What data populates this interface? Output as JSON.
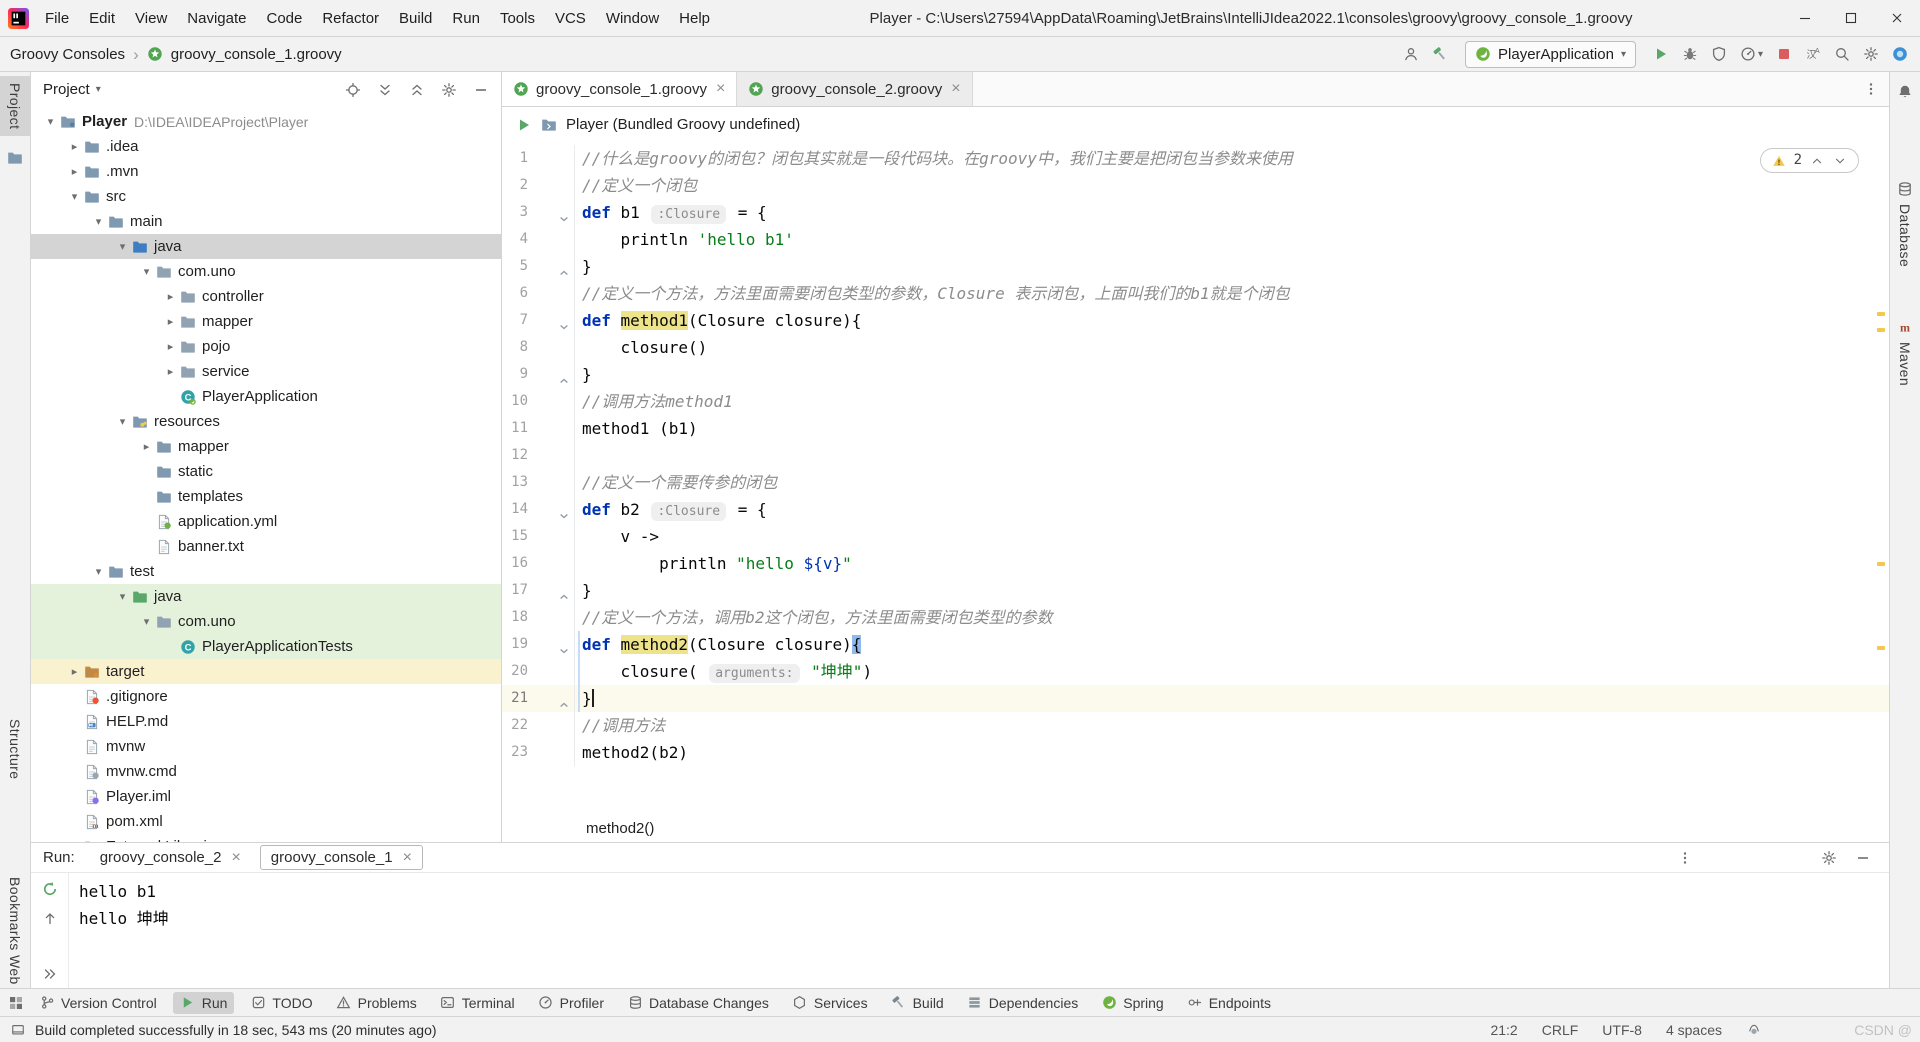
{
  "colors": {
    "accent_green": "#59A869",
    "warning_yellow": "#F2C94C",
    "selection_gray": "#D4D4D4",
    "test_green_bg": "#E4F2DC",
    "excluded_yellow_bg": "#FAF1CE",
    "current_line_bg": "#FCFAED",
    "keyword_blue": "#0033B3",
    "string_green": "#067D17",
    "comment_gray": "#8C8C8C",
    "stop_red": "#DB5C5C"
  },
  "titlebar": {
    "title": "Player - C:\\Users\\27594\\AppData\\Roaming\\JetBrains\\IntelliJIdea2022.1\\consoles\\groovy\\groovy_console_1.groovy",
    "menus": [
      "File",
      "Edit",
      "View",
      "Navigate",
      "Code",
      "Refactor",
      "Build",
      "Run",
      "Tools",
      "VCS",
      "Window",
      "Help"
    ]
  },
  "nav": {
    "breadcrumbs": [
      "Groovy Consoles",
      "groovy_console_1.groovy"
    ]
  },
  "toolbar": {
    "run_config_label": "PlayerApplication",
    "left": [
      {
        "name": "profile-settings",
        "icon": "user"
      },
      {
        "name": "build-project",
        "icon": "hammer"
      }
    ],
    "right": [
      {
        "name": "run",
        "icon": "play"
      },
      {
        "name": "debug",
        "icon": "bug"
      },
      {
        "name": "run-with-coverage",
        "icon": "shield"
      },
      {
        "name": "profiler",
        "icon": "gauge",
        "dropdown": true
      },
      {
        "name": "stop",
        "icon": "stop"
      },
      {
        "name": "translate",
        "icon": "translate"
      },
      {
        "name": "search-everywhere",
        "icon": "search"
      },
      {
        "name": "settings",
        "icon": "gear"
      },
      {
        "name": "code-with-me",
        "icon": "avatar"
      }
    ]
  },
  "left_stripe": [
    "Project",
    "Structure",
    "Bookmarks",
    "Web"
  ],
  "right_stripe": [
    "Database",
    "Maven"
  ],
  "project": {
    "header": "Project",
    "tree": [
      {
        "label": "Player",
        "sub": "D:\\IDEA\\IDEAProject\\Player",
        "icon": "folder-project",
        "level": 0,
        "arrow": "open",
        "bold": true
      },
      {
        "label": ".idea",
        "icon": "folder",
        "level": 1,
        "arrow": "closed"
      },
      {
        "label": ".mvn",
        "icon": "folder",
        "level": 1,
        "arrow": "closed"
      },
      {
        "label": "src",
        "icon": "folder",
        "level": 1,
        "arrow": "open"
      },
      {
        "label": "main",
        "icon": "folder",
        "level": 2,
        "arrow": "open"
      },
      {
        "label": "java",
        "icon": "folder-src",
        "level": 3,
        "arrow": "open",
        "bg": "sel"
      },
      {
        "label": "com.uno",
        "icon": "package",
        "level": 4,
        "arrow": "open"
      },
      {
        "label": "controller",
        "icon": "package",
        "level": 5,
        "arrow": "closed"
      },
      {
        "label": "mapper",
        "icon": "package",
        "level": 5,
        "arrow": "closed"
      },
      {
        "label": "pojo",
        "icon": "package",
        "level": 5,
        "arrow": "closed"
      },
      {
        "label": "service",
        "icon": "package",
        "level": 5,
        "arrow": "closed"
      },
      {
        "label": "PlayerApplication",
        "icon": "class-spring",
        "level": 5
      },
      {
        "label": "resources",
        "icon": "folder-resources",
        "level": 3,
        "arrow": "open"
      },
      {
        "label": "mapper",
        "icon": "folder",
        "level": 4,
        "arrow": "closed"
      },
      {
        "label": "static",
        "icon": "folder",
        "level": 4
      },
      {
        "label": "templates",
        "icon": "folder",
        "level": 4
      },
      {
        "label": "application.yml",
        "icon": "file-yml",
        "level": 4
      },
      {
        "label": "banner.txt",
        "icon": "file-txt",
        "level": 4
      },
      {
        "label": "test",
        "icon": "folder",
        "level": 2,
        "arrow": "open"
      },
      {
        "label": "java",
        "icon": "folder-test",
        "level": 3,
        "arrow": "open",
        "bg": "test"
      },
      {
        "label": "com.uno",
        "icon": "package",
        "level": 4,
        "arrow": "open",
        "bg": "test"
      },
      {
        "label": "PlayerApplicationTests",
        "icon": "class",
        "level": 5,
        "bg": "test"
      },
      {
        "label": "target",
        "icon": "folder-excluded",
        "level": 1,
        "arrow": "closed",
        "bg": "exc"
      },
      {
        "label": ".gitignore",
        "icon": "file-git",
        "level": 1
      },
      {
        "label": "HELP.md",
        "icon": "file-md",
        "level": 1
      },
      {
        "label": "mvnw",
        "icon": "file-plain",
        "level": 1
      },
      {
        "label": "mvnw.cmd",
        "icon": "file-cmd",
        "level": 1
      },
      {
        "label": "Player.iml",
        "icon": "file-iml",
        "level": 1
      },
      {
        "label": "pom.xml",
        "icon": "file-pom",
        "level": 1
      },
      {
        "label": "External Libraries",
        "icon": "folder-lib",
        "level": 1,
        "arrow": "closed"
      }
    ]
  },
  "editor": {
    "tabs": [
      {
        "label": "groovy_console_1.groovy",
        "active": true
      },
      {
        "label": "groovy_console_2.groovy",
        "active": false
      }
    ],
    "run_context": "Player (Bundled Groovy undefined)",
    "warnings": "2",
    "context_breadcrumb": "method2()",
    "lines": [
      {
        "n": 1,
        "segs": [
          [
            "cmt",
            "//什么是groovy的闭包？闭包其实就是一段代码块。在groovy中，我们主要是把闭包当参数来使用"
          ]
        ]
      },
      {
        "n": 2,
        "segs": [
          [
            "cmt",
            "//定义一个闭包"
          ]
        ]
      },
      {
        "n": 3,
        "fold": "down",
        "segs": [
          [
            "kw",
            "def"
          ],
          [
            "plain",
            " b1 "
          ],
          [
            "hint",
            ":Closure"
          ],
          [
            "plain",
            " = {"
          ]
        ]
      },
      {
        "n": 4,
        "segs": [
          [
            "plain",
            "    println "
          ],
          [
            "str",
            "'hello b1'"
          ]
        ]
      },
      {
        "n": 5,
        "fold": "up",
        "segs": [
          [
            "plain",
            "}"
          ]
        ]
      },
      {
        "n": 6,
        "segs": [
          [
            "cmt",
            "//定义一个方法，方法里面需要闭包类型的参数，Closure 表示闭包，上面叫我们的b1就是个闭包"
          ]
        ]
      },
      {
        "n": 7,
        "fold": "down",
        "segs": [
          [
            "kw",
            "def"
          ],
          [
            "plain",
            " "
          ],
          [
            "decl",
            "method1"
          ],
          [
            "plain",
            "(Closure closure){"
          ]
        ]
      },
      {
        "n": 8,
        "segs": [
          [
            "plain",
            "    closure()"
          ]
        ]
      },
      {
        "n": 9,
        "fold": "up",
        "segs": [
          [
            "plain",
            "}"
          ]
        ]
      },
      {
        "n": 10,
        "segs": [
          [
            "cmt",
            "//调用方法method1"
          ]
        ]
      },
      {
        "n": 11,
        "segs": [
          [
            "plain",
            "method1 (b1)"
          ]
        ]
      },
      {
        "n": 12,
        "segs": []
      },
      {
        "n": 13,
        "segs": [
          [
            "cmt",
            "//定义一个需要传参的闭包"
          ]
        ]
      },
      {
        "n": 14,
        "fold": "down",
        "segs": [
          [
            "kw",
            "def"
          ],
          [
            "plain",
            " b2 "
          ],
          [
            "hint",
            ":Closure"
          ],
          [
            "plain",
            " = {"
          ]
        ]
      },
      {
        "n": 15,
        "segs": [
          [
            "plain",
            "    v ->"
          ]
        ]
      },
      {
        "n": 16,
        "segs": [
          [
            "plain",
            "        println "
          ],
          [
            "str",
            "\"hello "
          ],
          [
            "interp",
            "${v}"
          ],
          [
            "str",
            "\""
          ]
        ]
      },
      {
        "n": 17,
        "fold": "up",
        "segs": [
          [
            "plain",
            "}"
          ]
        ]
      },
      {
        "n": 18,
        "segs": [
          [
            "cmt",
            "//定义一个方法，调用b2这个闭包，方法里面需要闭包类型的参数"
          ]
        ]
      },
      {
        "n": 19,
        "fold": "down",
        "segs": [
          [
            "kw",
            "def"
          ],
          [
            "plain",
            " "
          ],
          [
            "decl",
            "method2"
          ],
          [
            "plain",
            "(Closure closure)"
          ],
          [
            "brace",
            "{"
          ]
        ]
      },
      {
        "n": 20,
        "segs": [
          [
            "plain",
            "    closure( "
          ],
          [
            "hint",
            "arguments:"
          ],
          [
            "plain",
            " "
          ],
          [
            "str",
            "\"坤坤\""
          ],
          [
            "plain",
            ")"
          ]
        ]
      },
      {
        "n": 21,
        "fold": "up",
        "current": true,
        "caret": true,
        "segs": [
          [
            "plain",
            "}"
          ]
        ]
      },
      {
        "n": 22,
        "segs": [
          [
            "cmt",
            "//调用方法"
          ]
        ]
      },
      {
        "n": 23,
        "segs": [
          [
            "plain",
            "method2(b2)"
          ]
        ]
      }
    ]
  },
  "run_panel": {
    "label": "Run:",
    "tabs": [
      {
        "label": "groovy_console_2",
        "active": false
      },
      {
        "label": "groovy_console_1",
        "active": true
      }
    ],
    "output": [
      "hello b1",
      "hello 坤坤"
    ]
  },
  "bottom_bar": {
    "items": [
      {
        "label": "Version Control",
        "icon": "vcs"
      },
      {
        "label": "Run",
        "icon": "play-green",
        "active": true
      },
      {
        "label": "TODO",
        "icon": "todo"
      },
      {
        "label": "Problems",
        "icon": "problems"
      },
      {
        "label": "Terminal",
        "icon": "terminal"
      },
      {
        "label": "Profiler",
        "icon": "gauge"
      },
      {
        "label": "Database Changes",
        "icon": "database"
      },
      {
        "label": "Services",
        "icon": "services"
      },
      {
        "label": "Build",
        "icon": "hammer-gray"
      },
      {
        "label": "Dependencies",
        "icon": "deps"
      },
      {
        "label": "Spring",
        "icon": "spring"
      },
      {
        "label": "Endpoints",
        "icon": "endpoints"
      }
    ]
  },
  "status_bar": {
    "message": "Build completed successfully in 18 sec, 543 ms (20 minutes ago)",
    "caret_position": "21:2",
    "line_separator": "CRLF",
    "encoding": "UTF-8",
    "indent": "4 spaces",
    "watermark": "CSDN @"
  }
}
